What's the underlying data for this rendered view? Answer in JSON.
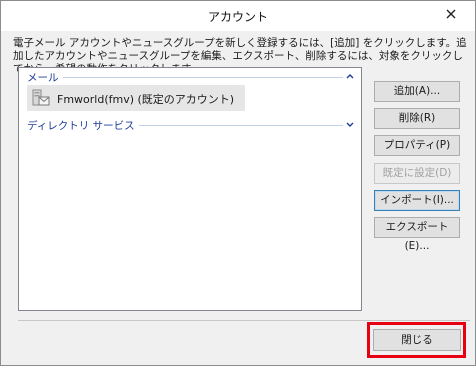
{
  "window": {
    "title": "アカウント"
  },
  "description": "電子メール アカウントやニュースグループを新しく登録するには、[追加] をクリックします。追加したアカウントやニュースグループを編集、エクスポート、削除するには、対象をクリックしてから、希望の動作をクリックします。",
  "list": {
    "groups": [
      {
        "label": "メール"
      },
      {
        "label": "ディレクトリ サービス"
      }
    ],
    "items": [
      {
        "label": "Fmworld(fmv) (既定のアカウント)"
      }
    ]
  },
  "buttons": {
    "add": "追加(A)...",
    "remove": "削除(R)",
    "properties": "プロパティ(P)",
    "set_default": "既定に設定(D)",
    "import": "インポート(I)...",
    "export": "エクスポート(E)...",
    "close": "閉じる"
  },
  "icons": {
    "close": "close-icon",
    "collapse": "chevron-up-icon",
    "expand": "chevron-down-icon",
    "account": "mail-account-icon"
  },
  "colors": {
    "group_header": "#1e3d96",
    "highlight": "#e60012"
  }
}
